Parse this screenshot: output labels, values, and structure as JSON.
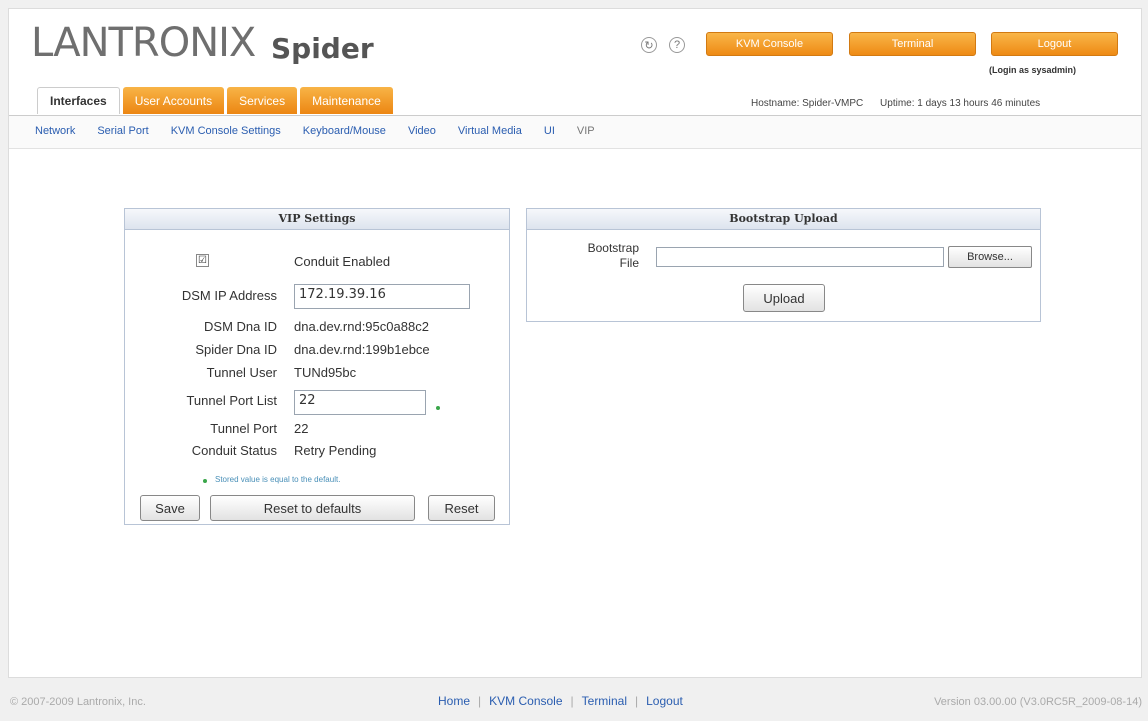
{
  "brand": {
    "logo_text": "LANTRONIX",
    "product": "Spider"
  },
  "header": {
    "buttons": [
      "KVM Console",
      "Terminal",
      "Logout"
    ],
    "login_as": "(Login as sysadmin)",
    "hostname": "Hostname: Spider-VMPC",
    "uptime": "Uptime: 1 days 13 hours 46 minutes"
  },
  "tabs": [
    {
      "label": "Interfaces",
      "active": true
    },
    {
      "label": "User Accounts",
      "active": false
    },
    {
      "label": "Services",
      "active": false
    },
    {
      "label": "Maintenance",
      "active": false
    }
  ],
  "subnav": [
    "Network",
    "Serial Port",
    "KVM Console Settings",
    "Keyboard/Mouse",
    "Video",
    "Virtual Media",
    "UI",
    "VIP"
  ],
  "vip": {
    "title": "VIP Settings",
    "conduit_enabled_label": "Conduit Enabled",
    "conduit_enabled_checked": "☑",
    "dsm_ip_label": "DSM IP Address",
    "dsm_ip_value": "172.19.39.16",
    "dsm_dna_label": "DSM Dna ID",
    "dsm_dna_value": "dna.dev.rnd:95c0a88c2",
    "spider_dna_label": "Spider Dna ID",
    "spider_dna_value": "dna.dev.rnd:199b1ebce",
    "tunnel_user_label": "Tunnel User",
    "tunnel_user_value": "TUNd95bc",
    "tunnel_port_list_label": "Tunnel Port List",
    "tunnel_port_list_value": "22",
    "tunnel_port_label": "Tunnel Port",
    "tunnel_port_value": "22",
    "conduit_status_label": "Conduit Status",
    "conduit_status_value": "Retry Pending",
    "note": "Stored value is equal to the default.",
    "save": "Save",
    "reset_defaults": "Reset to defaults",
    "reset": "Reset"
  },
  "bootstrap": {
    "title": "Bootstrap Upload",
    "file_label_1": "Bootstrap",
    "file_label_2": "File",
    "browse": "Browse...",
    "upload": "Upload"
  },
  "footer": {
    "copyright": "© 2007-2009 Lantronix, Inc.",
    "links": [
      "Home",
      "KVM Console",
      "Terminal",
      "Logout"
    ],
    "version": "Version 03.00.00 (V3.0RC5R_2009-08-14)"
  },
  "colors": {
    "accent_orange": "#f39a1d",
    "link_blue": "#2a5db0",
    "panel_border": "#b8c4d6"
  }
}
